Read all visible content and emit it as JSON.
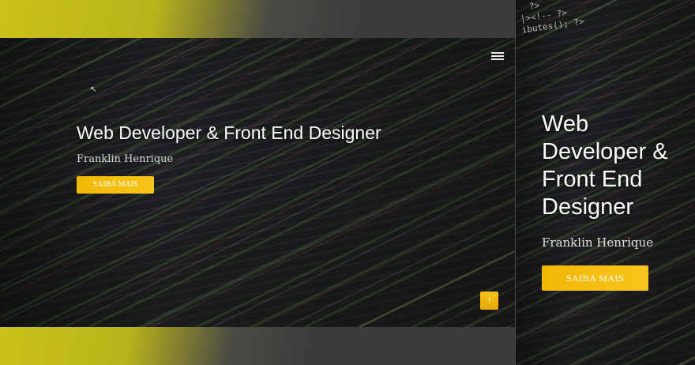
{
  "hero": {
    "title": "Web Developer & Front End Designer",
    "subtitle": "Franklin Henrique",
    "cta_label": "SAIBA MAIS"
  },
  "preview": {
    "title_lines": [
      "Web",
      "Developer &",
      "Front End",
      "Designer"
    ],
    "subtitle": "Franklin Henrique",
    "cta_label": "SAIBA MAIS",
    "code_snippet": "  ?>\n|><!-- ?>\nibutes(); ?>"
  },
  "icons": {
    "menu": "hamburger-icon",
    "back_to_top": "arrow-up-icon",
    "to_top_glyph": "↑"
  },
  "colors": {
    "accent": "#f5bc0f",
    "band": "#c9c21a"
  }
}
